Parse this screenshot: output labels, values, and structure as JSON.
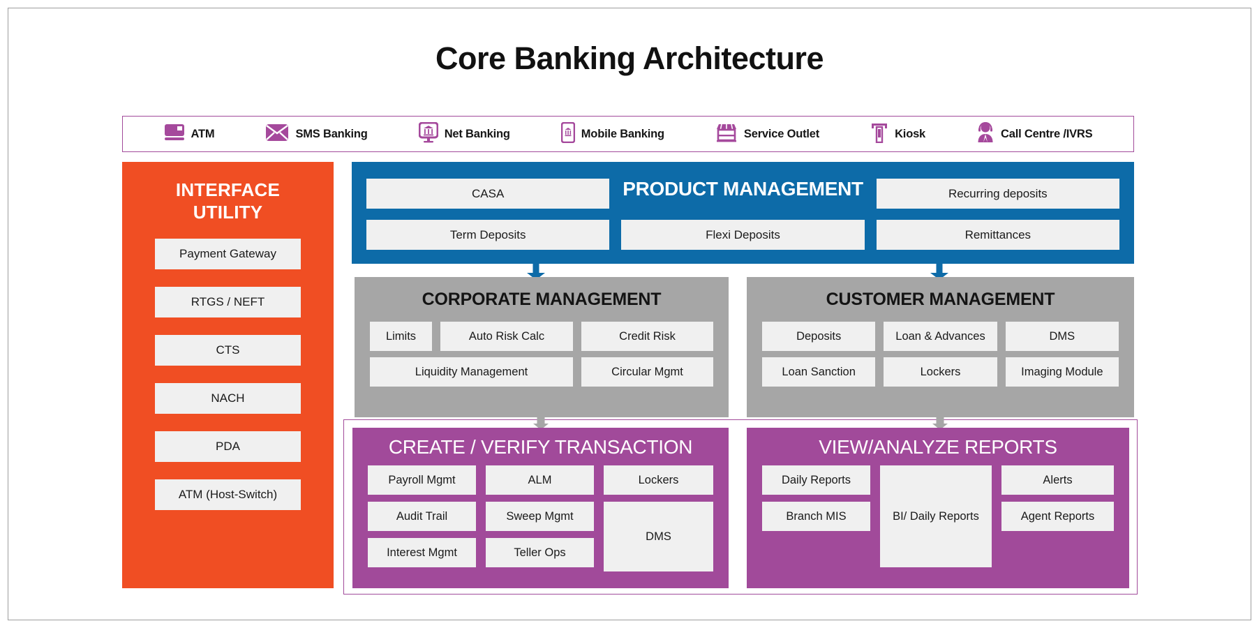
{
  "page": {
    "title": "Core Banking Architecture",
    "accent_purple": "#a14a9a",
    "accent_orange": "#f04e23",
    "accent_blue": "#0d6ba8",
    "accent_gray": "#a6a6a6",
    "chip_bg": "#f0f0f0"
  },
  "channels": {
    "items": [
      {
        "label": "ATM",
        "icon": "atm-card-icon"
      },
      {
        "label": "SMS Banking",
        "icon": "envelope-icon"
      },
      {
        "label": "Net Banking",
        "icon": "desktop-bank-icon"
      },
      {
        "label": "Mobile Banking",
        "icon": "mobile-bank-icon"
      },
      {
        "label": "Service Outlet",
        "icon": "storefront-icon"
      },
      {
        "label": "Kiosk",
        "icon": "kiosk-icon"
      },
      {
        "label": "Call Centre /IVRS",
        "icon": "headset-agent-icon"
      }
    ]
  },
  "interface_utility": {
    "title_line1": "INTERFACE",
    "title_line2": "UTILITY",
    "items": [
      "Payment Gateway",
      "RTGS / NEFT",
      "CTS",
      "NACH",
      "PDA",
      "ATM (Host-Switch)"
    ]
  },
  "product_management": {
    "title": "PRODUCT MANAGEMENT",
    "row1": [
      "CASA",
      "",
      "Recurring deposits"
    ],
    "row2": [
      "Term Deposits",
      "Flexi Deposits",
      "Remittances"
    ]
  },
  "corporate_management": {
    "title": "CORPORATE MANAGEMENT",
    "row1": [
      "Limits",
      "Auto Risk Calc",
      "Credit Risk"
    ],
    "row2": [
      "Liquidity Management",
      "Circular Mgmt"
    ]
  },
  "customer_management": {
    "title": "CUSTOMER MANAGEMENT",
    "row1": [
      "Deposits",
      "Loan & Advances",
      "DMS"
    ],
    "row2": [
      "Loan Sanction",
      "Lockers",
      "Imaging Module"
    ]
  },
  "create_verify": {
    "title": "CREATE / VERIFY TRANSACTION",
    "col1": [
      "Payroll Mgmt",
      "Audit Trail",
      "Interest Mgmt"
    ],
    "col2": [
      "ALM",
      "Sweep Mgmt",
      "Teller  Ops"
    ],
    "col3_top": "Lockers",
    "col3_bottom": "DMS"
  },
  "view_reports": {
    "title": "VIEW/ANALYZE REPORTS",
    "col1": [
      "Daily Reports",
      "Branch MIS"
    ],
    "col2": "BI/ Daily Reports",
    "col3": [
      "Alerts",
      "Agent Reports"
    ]
  }
}
